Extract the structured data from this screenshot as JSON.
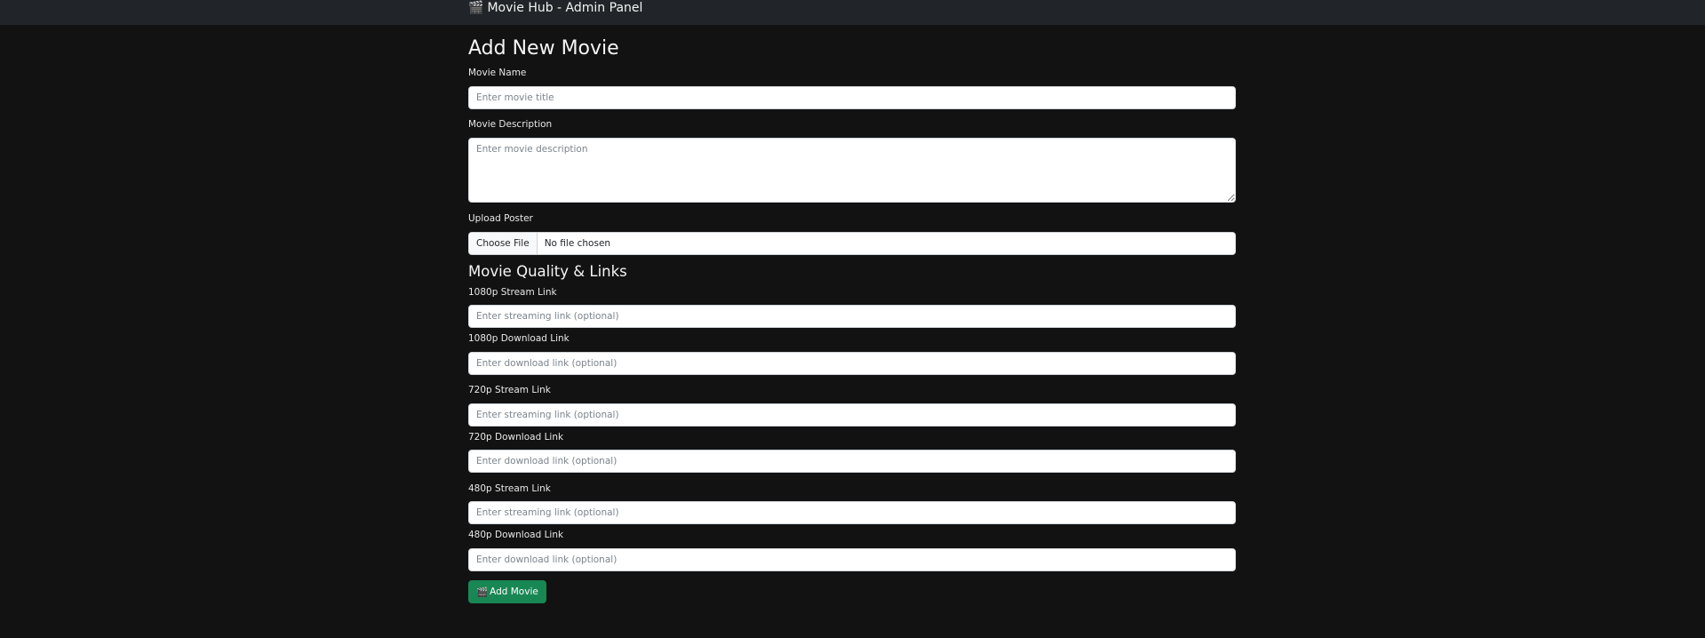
{
  "navbar": {
    "icon": "clapperboard-icon",
    "icon_glyph": "🎬",
    "title": "Movie Hub - Admin Panel"
  },
  "form": {
    "title": "Add New Movie",
    "movie_name": {
      "label": "Movie Name",
      "placeholder": "Enter movie title",
      "value": ""
    },
    "movie_description": {
      "label": "Movie Description",
      "placeholder": "Enter movie description",
      "value": ""
    },
    "upload_poster": {
      "label": "Upload Poster",
      "button_label": "Choose File",
      "status": "No file chosen"
    },
    "quality_section_title": "Movie Quality & Links",
    "links": [
      {
        "label": "1080p Stream Link",
        "placeholder": "Enter streaming link (optional)",
        "value": ""
      },
      {
        "label": "1080p Download Link",
        "placeholder": "Enter download link (optional)",
        "value": ""
      },
      {
        "label": "720p Stream Link",
        "placeholder": "Enter streaming link (optional)",
        "value": ""
      },
      {
        "label": "720p Download Link",
        "placeholder": "Enter download link (optional)",
        "value": ""
      },
      {
        "label": "480p Stream Link",
        "placeholder": "Enter streaming link (optional)",
        "value": ""
      },
      {
        "label": "480p Download Link",
        "placeholder": "Enter download link (optional)",
        "value": ""
      }
    ],
    "submit": {
      "icon": "clapperboard-icon",
      "icon_glyph": "🎬",
      "label": "Add Movie"
    }
  },
  "colors": {
    "background": "#121212",
    "navbar": "#212529",
    "submit_button": "#198754"
  }
}
